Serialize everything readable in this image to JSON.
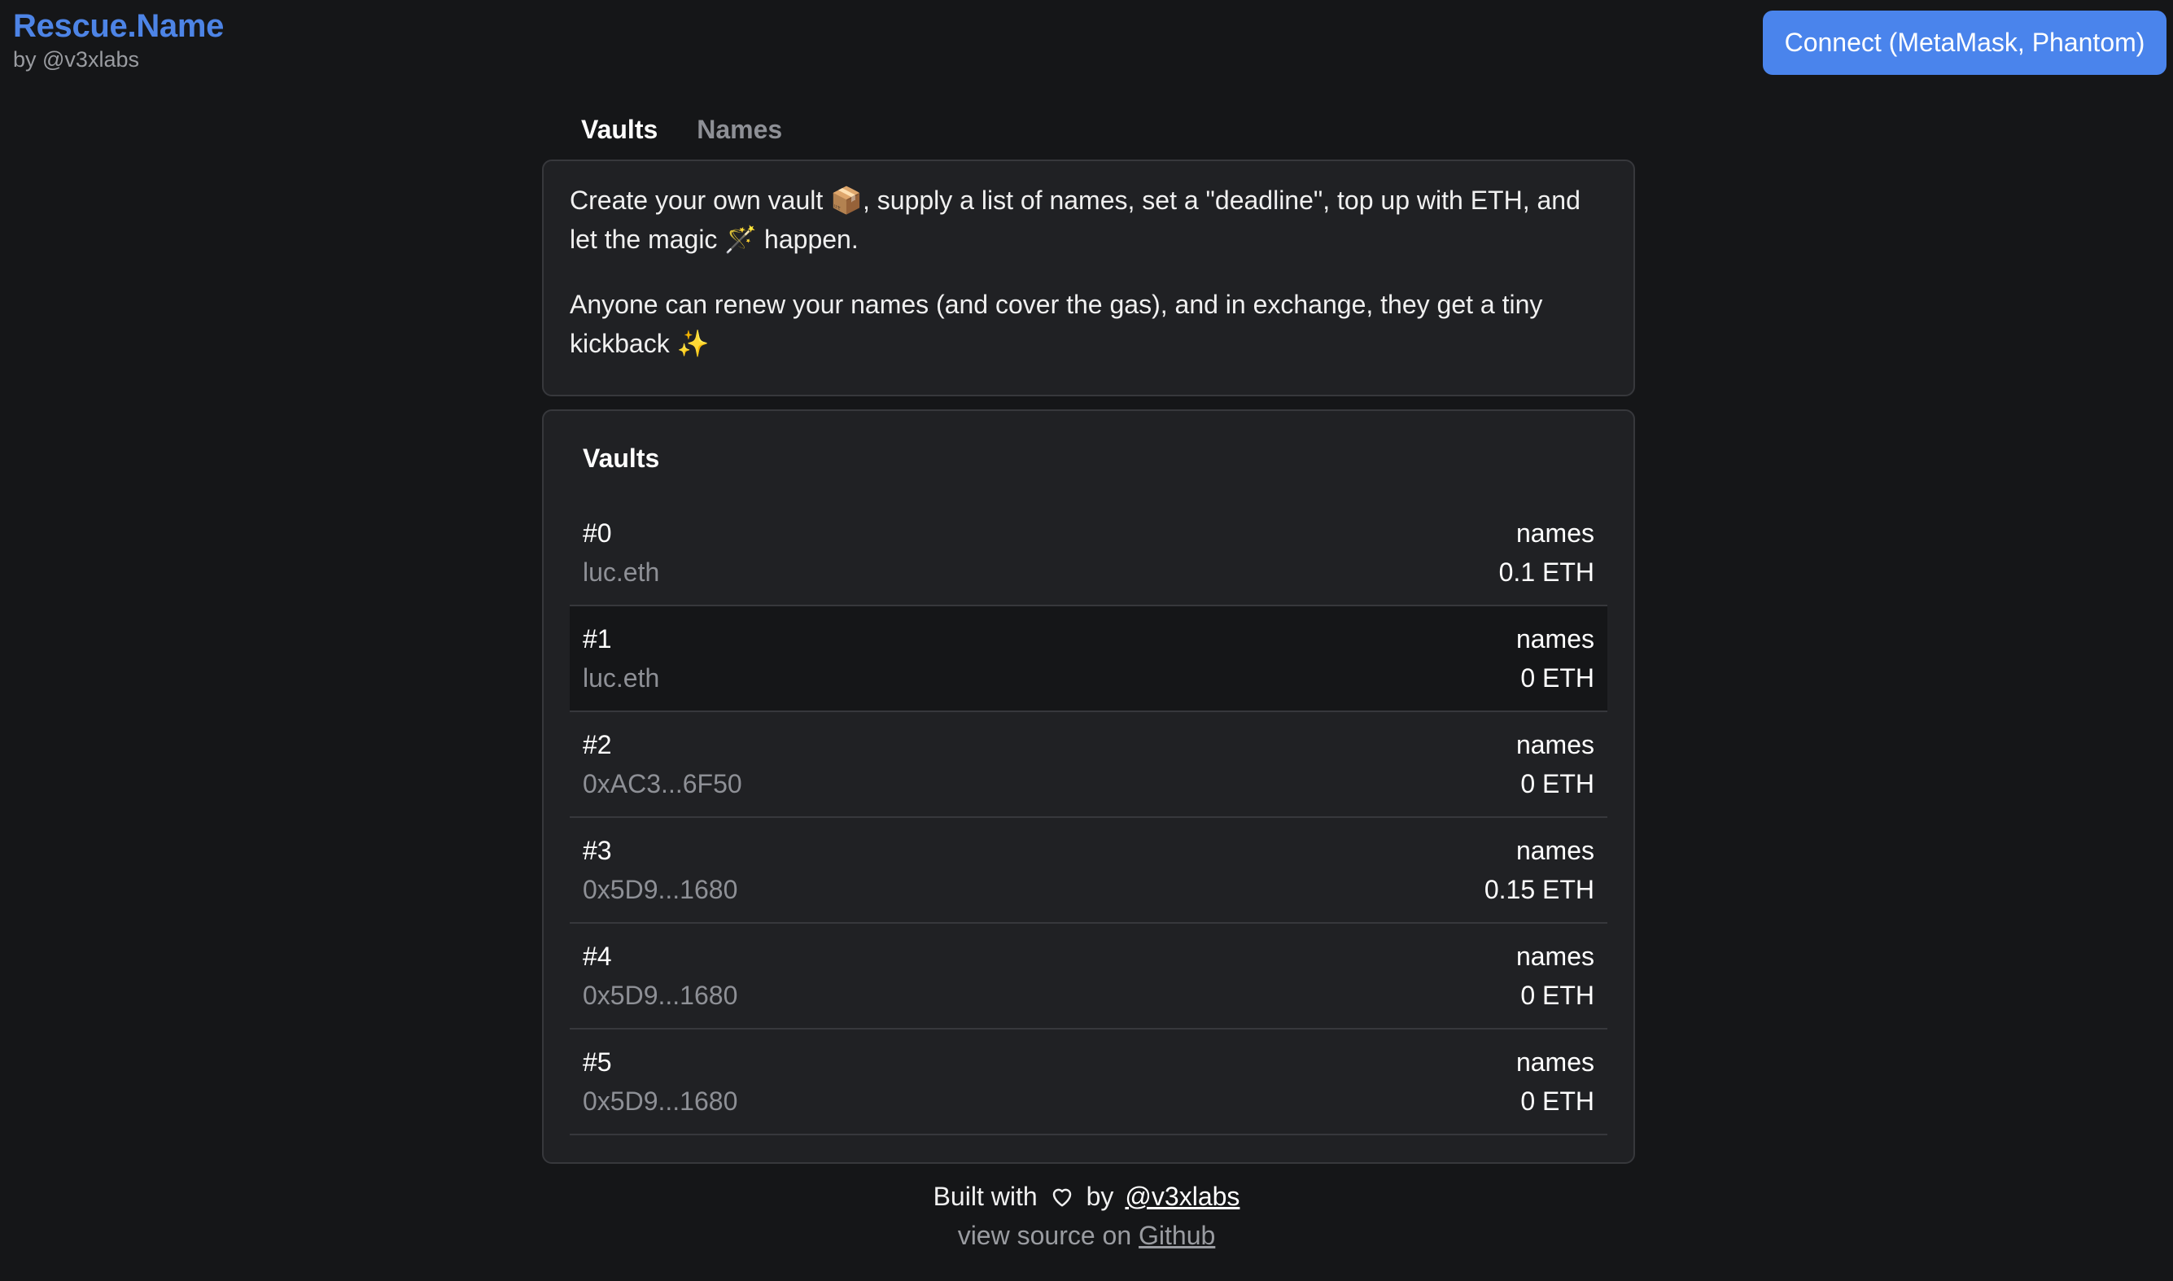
{
  "header": {
    "title": "Rescue.Name",
    "subtitle": "by @v3xlabs",
    "connect_label": "Connect (MetaMask, Phantom)"
  },
  "tabs": [
    {
      "label": "Vaults",
      "active": true
    },
    {
      "label": "Names",
      "active": false
    }
  ],
  "intro": {
    "p1": "Create your own vault 📦, supply a list of names, set a \"deadline\", top up with ETH, and let the magic 🪄 happen.",
    "p2": "Anyone can renew your names (and cover the gas), and in exchange, they get a tiny kickback ✨"
  },
  "vaults": {
    "title": "Vaults",
    "rows": [
      {
        "id": "#0",
        "owner": "luc.eth",
        "names": "names",
        "balance": "0.1 ETH"
      },
      {
        "id": "#1",
        "owner": "luc.eth",
        "names": "names",
        "balance": "0 ETH"
      },
      {
        "id": "#2",
        "owner": "0xAC3...6F50",
        "names": "names",
        "balance": "0 ETH"
      },
      {
        "id": "#3",
        "owner": "0x5D9...1680",
        "names": "names",
        "balance": "0.15 ETH"
      },
      {
        "id": "#4",
        "owner": "0x5D9...1680",
        "names": "names",
        "balance": "0 ETH"
      },
      {
        "id": "#5",
        "owner": "0x5D9...1680",
        "names": "names",
        "balance": "0 ETH"
      }
    ]
  },
  "footer": {
    "built_with": "Built with",
    "by": "by",
    "author_link": "@v3xlabs",
    "source_prefix": "view source on",
    "source_link": "Github"
  },
  "colors": {
    "background": "#151618",
    "card": "#202124",
    "accent": "#4a84ec",
    "brand": "#4d84e6",
    "muted": "#8e9096"
  },
  "icons": {
    "heart": "heart-icon"
  }
}
